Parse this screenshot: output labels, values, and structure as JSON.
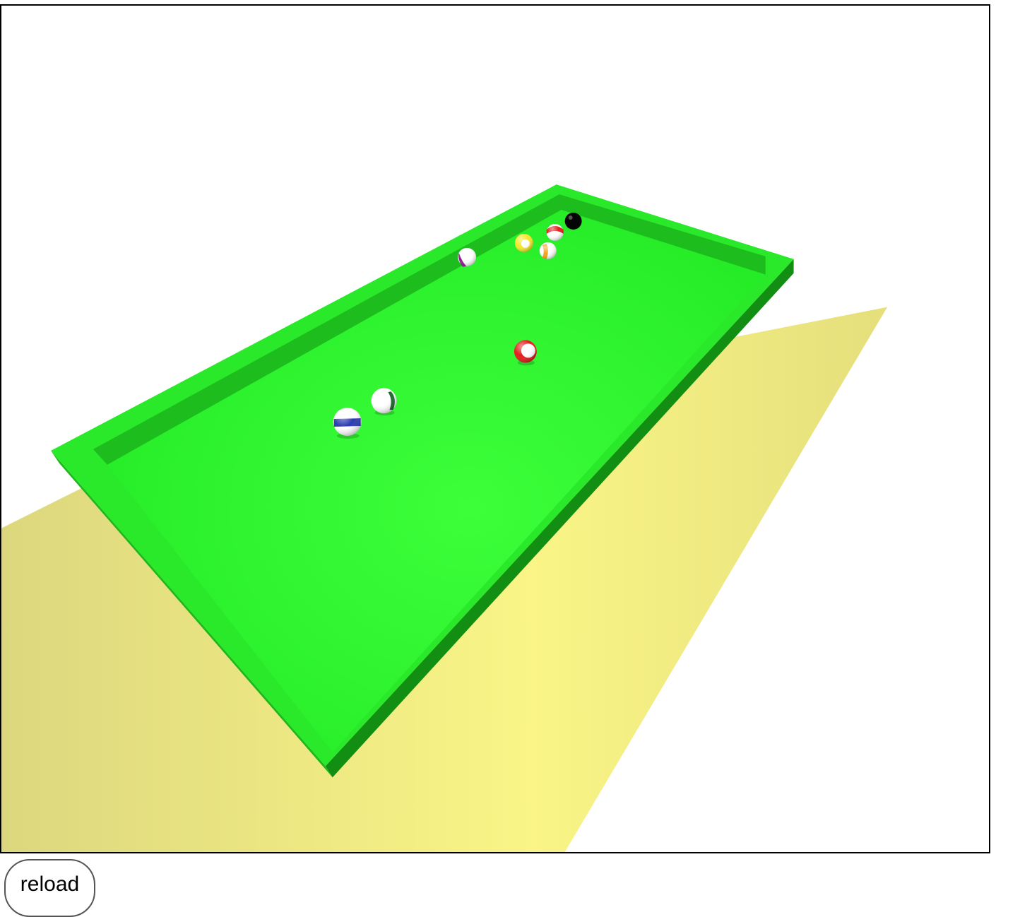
{
  "controls": {
    "reload_label": "reload"
  },
  "scene": {
    "floor_color": "#f4f07a",
    "table_color": "#2ff230",
    "rail_color": "#22d422",
    "cushion_color": "#1ea81e",
    "side_color": "#128f12",
    "balls": [
      {
        "name": "ball-black-8",
        "color": "#000000",
        "kind": "solid"
      },
      {
        "name": "ball-red-stripe",
        "color": "#e31b1b",
        "kind": "stripe"
      },
      {
        "name": "ball-yellow-1",
        "color": "#f2e21a",
        "kind": "solid"
      },
      {
        "name": "ball-orange-stripe",
        "color": "#f2a21a",
        "kind": "stripe"
      },
      {
        "name": "ball-purple-stripe",
        "color": "#8e1a8e",
        "kind": "stripe"
      },
      {
        "name": "ball-red-3",
        "color": "#e31b1b",
        "kind": "solid"
      },
      {
        "name": "ball-green-stripe",
        "color": "#176a2c",
        "kind": "stripe"
      },
      {
        "name": "ball-blue-stripe",
        "color": "#2a3bb0",
        "kind": "stripe"
      }
    ]
  }
}
